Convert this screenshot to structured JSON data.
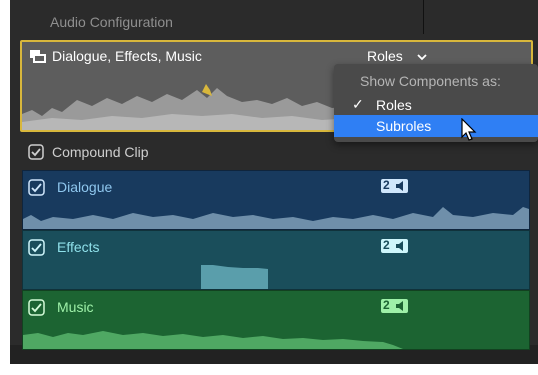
{
  "panel": {
    "title": "Audio Configuration"
  },
  "clip": {
    "name": "Dialogue, Effects, Music",
    "roles_button_label": "Roles",
    "icon": "clip-icon",
    "border_color": "#d8b73c"
  },
  "menu": {
    "header": "Show Components as:",
    "items": [
      {
        "label": "Roles",
        "check": "✓",
        "selected": true
      },
      {
        "label": "Subroles",
        "check": "",
        "highlighted": true
      }
    ],
    "highlight_color": "#2f7ff4"
  },
  "compound": {
    "label": "Compound Clip",
    "checked": true
  },
  "lanes": [
    {
      "name": "Dialogue",
      "badge": "2",
      "color": "#183a5e",
      "checked": true,
      "icon": "speaker-icon"
    },
    {
      "name": "Effects",
      "badge": "2",
      "color": "#1a4e5b",
      "checked": true,
      "icon": "speaker-icon"
    },
    {
      "name": "Music",
      "badge": "2",
      "color": "#1c6432",
      "checked": true,
      "icon": "speaker-icon"
    }
  ]
}
